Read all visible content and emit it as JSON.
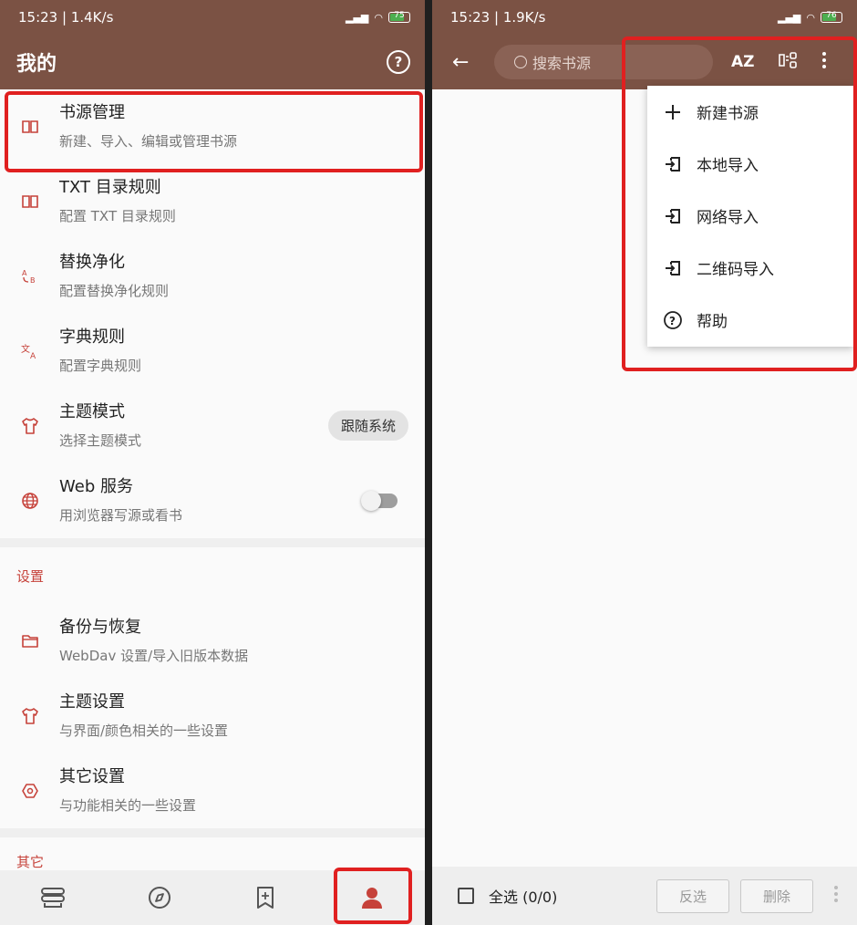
{
  "left": {
    "status": {
      "time": "15:23 | 1.4K/s",
      "battery": "75"
    },
    "title": "我的",
    "items": [
      {
        "title": "书源管理",
        "subtitle": "新建、导入、编辑或管理书源",
        "icon": "book-icon"
      },
      {
        "title": "TXT 目录规则",
        "subtitle": "配置 TXT 目录规则",
        "icon": "book-icon"
      },
      {
        "title": "替换净化",
        "subtitle": "配置替换净化规则",
        "icon": "replace-ab-icon"
      },
      {
        "title": "字典规则",
        "subtitle": "配置字典规则",
        "icon": "translate-icon"
      },
      {
        "title": "主题模式",
        "subtitle": "选择主题模式",
        "icon": "shirt-icon",
        "value": "跟随系统"
      },
      {
        "title": "Web 服务",
        "subtitle": "用浏览器写源或看书",
        "icon": "globe-icon",
        "toggle": false
      }
    ],
    "section_settings": "设置",
    "settings_items": [
      {
        "title": "备份与恢复",
        "subtitle": "WebDav 设置/导入旧版本数据",
        "icon": "folder-icon"
      },
      {
        "title": "主题设置",
        "subtitle": "与界面/颜色相关的一些设置",
        "icon": "shirt-icon"
      },
      {
        "title": "其它设置",
        "subtitle": "与功能相关的一些设置",
        "icon": "settings-hexagon-icon"
      }
    ],
    "section_other": "其它",
    "bottom_nav": [
      "bookshelf-icon",
      "compass-icon",
      "bookmark-add-icon",
      "person-icon"
    ]
  },
  "right": {
    "status": {
      "time": "15:23 | 1.9K/s",
      "battery": "76"
    },
    "search": {
      "placeholder": "搜索书源"
    },
    "actions": [
      "sort-az-icon",
      "group-icon",
      "more-vert-icon"
    ],
    "menu": [
      {
        "label": "新建书源",
        "icon": "plus-icon"
      },
      {
        "label": "本地导入",
        "icon": "import-icon"
      },
      {
        "label": "网络导入",
        "icon": "import-icon"
      },
      {
        "label": "二维码导入",
        "icon": "import-icon"
      },
      {
        "label": "帮助",
        "icon": "help-icon"
      }
    ],
    "bottom": {
      "select_all": "全选 (0/0)",
      "invert": "反选",
      "delete": "删除"
    }
  },
  "colors": {
    "appbar": "#7b5244",
    "accent": "#c6423a",
    "highlight": "#e02020"
  }
}
